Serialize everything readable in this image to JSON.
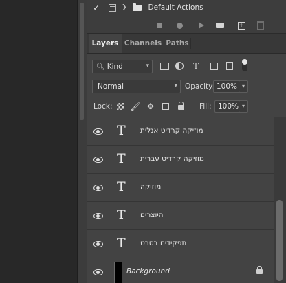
{
  "actions": {
    "set_name": "Default Actions"
  },
  "tabs": [
    {
      "label": "Layers",
      "active": true
    },
    {
      "label": "Channels",
      "active": false
    },
    {
      "label": "Paths",
      "active": false
    }
  ],
  "filter": {
    "kind_label": "Kind",
    "icons": [
      "pixel-layer-filter-icon",
      "adjustment-layer-filter-icon",
      "type-layer-filter-icon",
      "shape-layer-filter-icon",
      "smart-object-filter-icon"
    ]
  },
  "blend": {
    "mode": "Normal",
    "opacity_label": "Opacity:",
    "opacity_value": "100%"
  },
  "lock": {
    "label": "Lock:",
    "fill_label": "Fill:",
    "fill_value": "100%"
  },
  "layers": [
    {
      "name": "מוזיקה קרדיט אנלית",
      "type": "text"
    },
    {
      "name": "מוזיקה קרדיט עברית",
      "type": "text"
    },
    {
      "name": "מוזיקה",
      "type": "text"
    },
    {
      "name": "היוצרים",
      "type": "text"
    },
    {
      "name": "תפקידים בסרט",
      "type": "text"
    },
    {
      "name": "Background",
      "type": "background",
      "locked": true
    }
  ],
  "colors": {
    "panel_bg": "#434343",
    "tabbar_bg": "#383838",
    "text": "#e6e6e6"
  }
}
